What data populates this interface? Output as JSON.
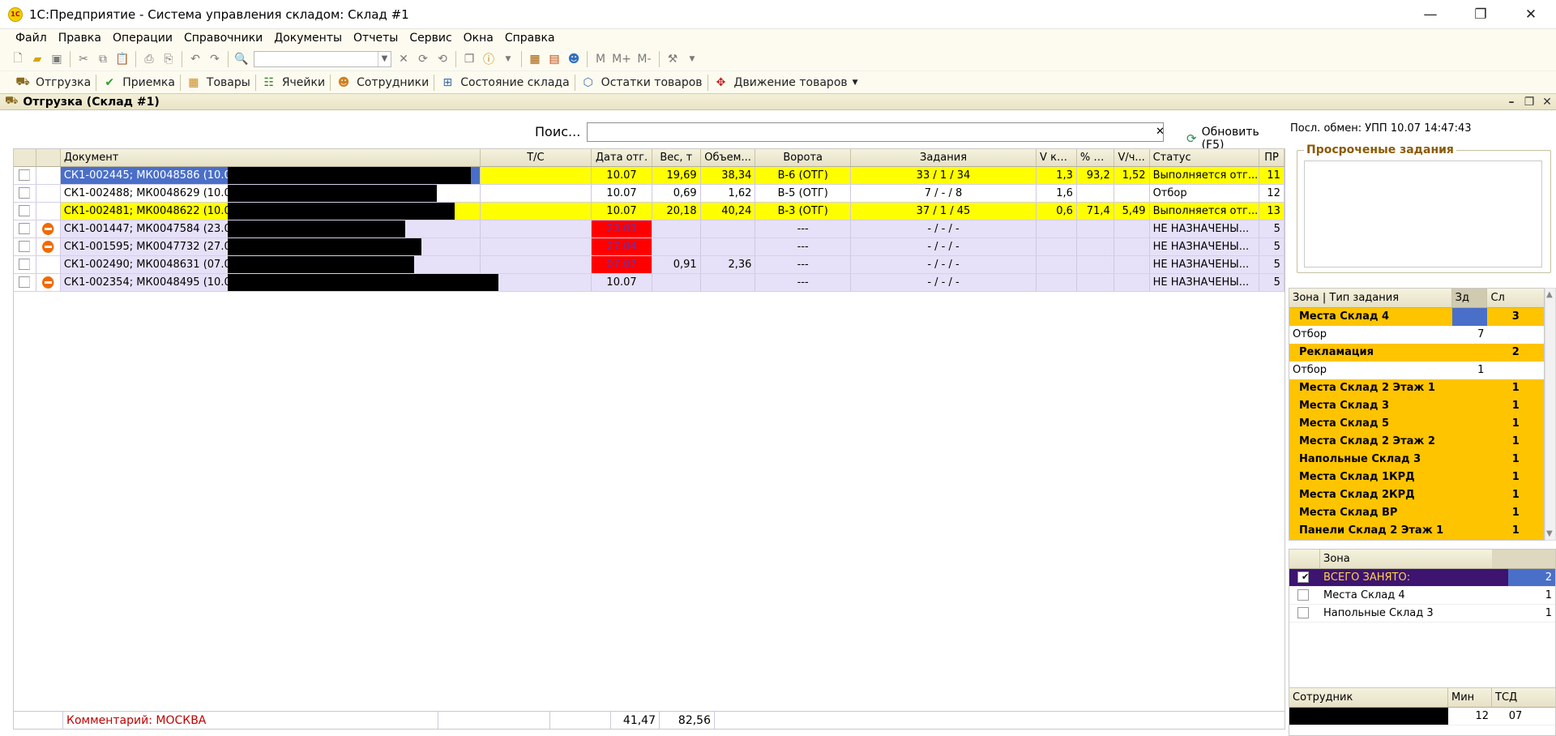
{
  "window": {
    "title": "1С:Предприятие - Система управления складом: Склад #1",
    "logo": "1С",
    "minimize": "—",
    "restore": "❐",
    "close": "✕"
  },
  "menu": [
    {
      "label": "Файл"
    },
    {
      "label": "Правка"
    },
    {
      "label": "Операции"
    },
    {
      "label": "Справочники"
    },
    {
      "label": "Документы"
    },
    {
      "label": "Отчеты"
    },
    {
      "label": "Сервис"
    },
    {
      "label": "Окна"
    },
    {
      "label": "Справка"
    }
  ],
  "toolbar": {
    "m": "M",
    "mplus": "M+",
    "mminus": "M-"
  },
  "quickbar": [
    {
      "label": "Отгрузка",
      "icon": "truck-icon"
    },
    {
      "label": "Приемка",
      "icon": "check-icon"
    },
    {
      "label": "Товары",
      "icon": "box-icon"
    },
    {
      "label": "Ячейки",
      "icon": "cells-icon"
    },
    {
      "label": "Сотрудники",
      "icon": "people-icon"
    },
    {
      "label": "Состояние склада",
      "icon": "warehouse-icon"
    },
    {
      "label": "Остатки товаров",
      "icon": "cube-icon"
    },
    {
      "label": "Движение товаров",
      "icon": "move-icon"
    }
  ],
  "doc": {
    "title": "Отгрузка (Склад #1)"
  },
  "search": {
    "label": "Поис...",
    "value": "",
    "clear": "✕",
    "refresh": "Обновить (F5)"
  },
  "grid": {
    "headers": [
      "",
      "",
      "Документ",
      "Т/С",
      "Дата отг.",
      "Вес, т",
      "Объем...",
      "Ворота",
      "Задания",
      "V ко...",
      "% В...",
      "V/ч...",
      "Статус",
      "ПР"
    ],
    "rows": [
      {
        "doc": "СК1-002445; МК0048586 (10.07); I",
        "ts": "",
        "date": "10.07",
        "weight": "19,69",
        "volume": "38,34",
        "gate": "В-6 (ОТГ)",
        "tasks": "33 / 1 / 34",
        "v": "1,3",
        "pct": "93,2",
        "vh": "1,52",
        "status": "Выполняется отг...",
        "pr": "11",
        "style": "yellow",
        "selected": true,
        "stop": false,
        "datered": false
      },
      {
        "doc": "СК1-002488; МК0048629 (10.07); С",
        "ts": "",
        "date": "10.07",
        "weight": "0,69",
        "volume": "1,62",
        "gate": "В-5 (ОТГ)",
        "tasks": "7 / - / 8",
        "v": "1,6",
        "pct": "",
        "vh": "",
        "status": "Отбор",
        "pr": "12",
        "style": "white",
        "selected": false,
        "stop": false,
        "datered": false
      },
      {
        "doc": "СК1-002481; МК0048622 (10.07); Б",
        "ts": "",
        "date": "10.07",
        "weight": "20,18",
        "volume": "40,24",
        "gate": "В-3 (ОТГ)",
        "tasks": "37 / 1 / 45",
        "v": "0,6",
        "pct": "71,4",
        "vh": "5,49",
        "status": "Выполняется отг...",
        "pr": "13",
        "style": "yellow",
        "selected": false,
        "stop": false,
        "datered": false
      },
      {
        "doc": "СК1-001447; МК0047584 (23.03); Б",
        "ts": "",
        "date": "23.03",
        "weight": "",
        "volume": "",
        "gate": "---",
        "tasks": "- / - / -",
        "v": "",
        "pct": "",
        "vh": "",
        "status": "НЕ НАЗНАЧЕНЫ...",
        "pr": "5",
        "style": "lavender",
        "selected": false,
        "stop": true,
        "datered": true
      },
      {
        "doc": "СК1-001595; МК0047732 (27.04); С",
        "ts": "",
        "date": "27.04",
        "weight": "",
        "volume": "",
        "gate": "---",
        "tasks": "- / - / -",
        "v": "",
        "pct": "",
        "vh": "",
        "status": "НЕ НАЗНАЧЕНЫ...",
        "pr": "5",
        "style": "lavender",
        "selected": false,
        "stop": true,
        "datered": true
      },
      {
        "doc": "СК1-002490; МК0048631 (07.07); Г",
        "ts": "",
        "date": "07.07",
        "weight": "0,91",
        "volume": "2,36",
        "gate": "---",
        "tasks": "- / - / -",
        "v": "",
        "pct": "",
        "vh": "",
        "status": "НЕ НАЗНАЧЕНЫ...",
        "pr": "5",
        "style": "lavender",
        "selected": false,
        "stop": false,
        "datered": true
      },
      {
        "doc": "СК1-002354; МК0048495 (10.07); Е",
        "ts": "",
        "date": "10.07",
        "weight": "",
        "volume": "",
        "gate": "---",
        "tasks": "- / - / -",
        "v": "",
        "pct": "",
        "vh": "",
        "status": "НЕ НАЗНАЧЕНЫ...",
        "pr": "5",
        "style": "lavender",
        "selected": false,
        "stop": true,
        "datered": false
      }
    ],
    "footer": {
      "comment": "Комментарий: МОСКВА",
      "weight": "41,47",
      "volume": "82,56"
    }
  },
  "right": {
    "last_exchange": "Посл. обмен: УПП 10.07 14:47:43",
    "overdue_title": "Просроченые задания",
    "zone_headers": [
      "Зона | Тип задания",
      "Зд",
      "Сл"
    ],
    "zones": [
      {
        "name": "Места Склад 4",
        "zd": "",
        "sl": "3",
        "group": true
      },
      {
        "name": "Отбор",
        "zd": "7",
        "sl": "",
        "group": false
      },
      {
        "name": "Рекламация",
        "zd": "",
        "sl": "2",
        "group": true
      },
      {
        "name": "Отбор",
        "zd": "1",
        "sl": "",
        "group": false
      },
      {
        "name": "Места Склад 2 Этаж 1",
        "zd": "",
        "sl": "1",
        "group": true
      },
      {
        "name": "Места Склад 3",
        "zd": "",
        "sl": "1",
        "group": true
      },
      {
        "name": "Места Склад 5",
        "zd": "",
        "sl": "1",
        "group": true
      },
      {
        "name": "Места Склад 2 Этаж 2",
        "zd": "",
        "sl": "1",
        "group": true
      },
      {
        "name": "Напольные Склад 3",
        "zd": "",
        "sl": "1",
        "group": true
      },
      {
        "name": "Места Склад 1КРД",
        "zd": "",
        "sl": "1",
        "group": true
      },
      {
        "name": "Места Склад 2КРД",
        "zd": "",
        "sl": "1",
        "group": true
      },
      {
        "name": "Места Склад ВР",
        "zd": "",
        "sl": "1",
        "group": true
      },
      {
        "name": "Панели Склад 2 Этаж 1",
        "zd": "",
        "sl": "1",
        "group": true
      }
    ],
    "zone_filter_header": "Зона",
    "zone_filter": [
      {
        "name": "ВСЕГО ЗАНЯТО:",
        "count": "2",
        "checked": true,
        "total": true
      },
      {
        "name": "Места Склад 4",
        "count": "1",
        "checked": false,
        "total": false
      },
      {
        "name": "Напольные Склад 3",
        "count": "1",
        "checked": false,
        "total": false
      }
    ],
    "emp_headers": [
      "Сотрудник",
      "Мин",
      "ТСД"
    ],
    "emp_rows": [
      {
        "name": "",
        "min": "12",
        "tsd": "07"
      }
    ]
  },
  "colors": {
    "yellow": "#ffff00",
    "lavender": "#e6e1f8",
    "selected": "#4a6fc8",
    "red": "#ff0000",
    "zone_group": "#ffc400",
    "total_row": "#3d1470"
  }
}
